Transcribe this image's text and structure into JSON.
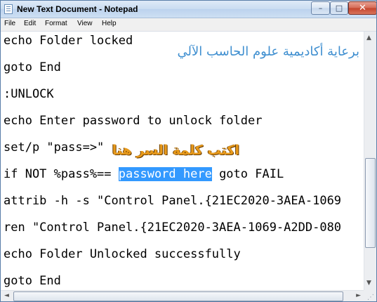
{
  "window": {
    "title": "New Text Document - Notepad",
    "controls": {
      "minimize": "–",
      "maximize": "□",
      "close": "✕"
    }
  },
  "menu": [
    "File",
    "Edit",
    "Format",
    "View",
    "Help"
  ],
  "editor": {
    "lines": [
      "echo Folder locked",
      "goto End",
      ":UNLOCK",
      "echo Enter password to unlock folder",
      "set/p \"pass=>\"",
      "if NOT %pass%== ",
      "attrib -h -s \"Control Panel.{21EC2020-3AEA-1069",
      "ren \"Control Panel.{21EC2020-3AEA-1069-A2DD-080",
      "echo Folder Unlocked successfully",
      "goto End"
    ],
    "selected_text": "password here",
    "after_selection": " goto FAIL"
  },
  "overlays": {
    "sponsor_text": "برعاية أكاديمية علوم الحاسب الآلي",
    "hint_text": "اكتب كلمة السر هنا"
  },
  "scrollbar_arrows": {
    "up": "▲",
    "down": "▼",
    "left": "◄",
    "right": "►"
  },
  "colors": {
    "selection": "#3399ff",
    "sponsor_text": "#3f8fd0",
    "hint_text": "#e89a1b",
    "close_button": "#c4432b"
  }
}
